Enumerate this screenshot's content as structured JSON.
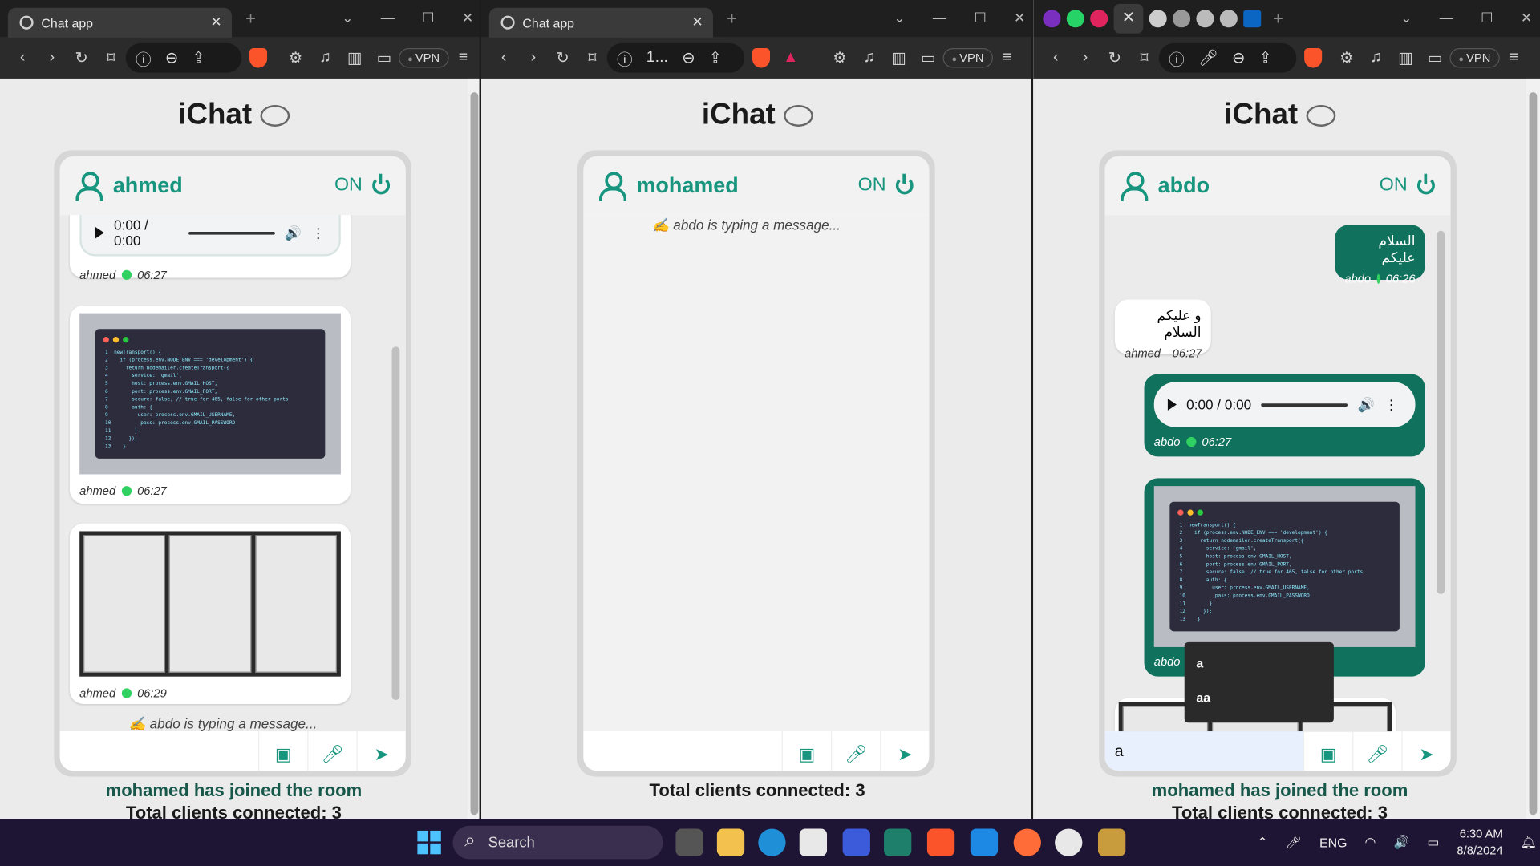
{
  "browser": {
    "tab_title": "Chat app",
    "addr_truncated": "1...",
    "vpn_label": "VPN"
  },
  "app": {
    "title": "iChat"
  },
  "windows": [
    {
      "user": "ahmed",
      "status": "ON",
      "messages": [
        {
          "type": "audio",
          "time_text": "0:00 / 0:00",
          "sender": "ahmed",
          "time": "06:27"
        },
        {
          "type": "image-code",
          "sender": "ahmed",
          "time": "06:27"
        },
        {
          "type": "image-screenshot",
          "sender": "ahmed",
          "time": "06:29"
        }
      ],
      "typing": "✍️ abdo is typing a message...",
      "composer_value": "",
      "join_notice": "mohamed has joined the room",
      "clients": "Total clients connected: 3"
    },
    {
      "user": "mohamed",
      "status": "ON",
      "typing": "✍️ abdo is typing a message...",
      "composer_value": "",
      "clients": "Total clients connected: 3"
    },
    {
      "user": "abdo",
      "status": "ON",
      "messages": [
        {
          "type": "text",
          "dir": "out",
          "text": "السلام عليكم",
          "sender": "abdo",
          "time": "06:26"
        },
        {
          "type": "text",
          "dir": "in",
          "text": "و عليكم السلام",
          "sender": "ahmed",
          "time": "06:27"
        },
        {
          "type": "audio",
          "dir": "out",
          "time_text": "0:00 / 0:00",
          "sender": "abdo",
          "time": "06:27"
        },
        {
          "type": "image-code",
          "dir": "out",
          "sender": "abdo"
        }
      ],
      "composer_value": "a",
      "autocomplete": [
        "a",
        "aa"
      ],
      "join_notice": "mohamed has joined the room",
      "clients": "Total clients connected: 3"
    }
  ],
  "code_lines": [
    "newTransport() {",
    "  if (process.env.NODE_ENV === 'development') {",
    "    return nodemailer.createTransport({",
    "      service: 'gmail',",
    "      host: process.env.GMAIL_HOST,",
    "      port: process.env.GMAIL_PORT,",
    "      secure: false, // true for 465, false for other ports",
    "      auth: {",
    "        user: process.env.GMAIL_USERNAME,",
    "        pass: process.env.GMAIL_PASSWORD",
    "      }",
    "    });",
    "  }"
  ],
  "taskbar": {
    "search_label": "Search",
    "language": "ENG",
    "time": "6:30 AM",
    "date": "8/8/2024"
  },
  "colors": {
    "accent": "#17957e",
    "bubble_out": "#10715c",
    "status_dot": "#2fd160"
  }
}
